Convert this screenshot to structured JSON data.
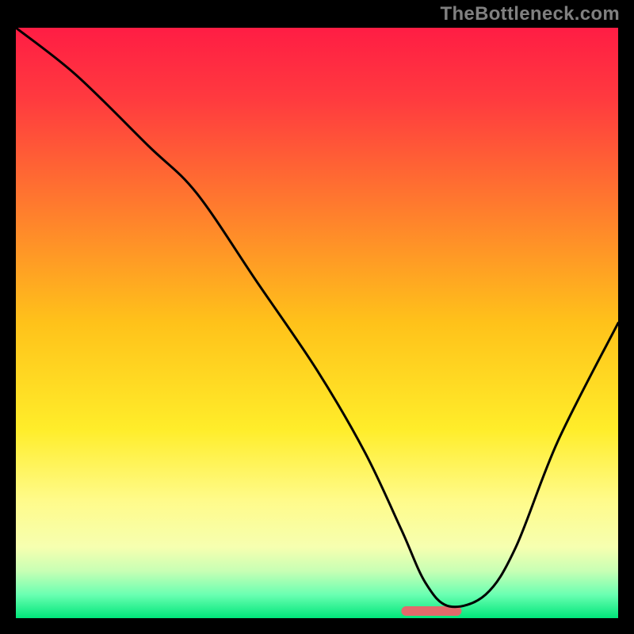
{
  "watermark": "TheBottleneck.com",
  "chart_data": {
    "type": "line",
    "title": "",
    "xlabel": "",
    "ylabel": "",
    "xlim": [
      0,
      100
    ],
    "ylim": [
      0,
      100
    ],
    "legend": false,
    "grid": false,
    "series": [
      {
        "name": "curve",
        "x": [
          0,
          10,
          22,
          30,
          40,
          50,
          58,
          64,
          68,
          72,
          78,
          83,
          90,
          100
        ],
        "y": [
          100,
          92,
          80,
          72,
          57,
          42,
          28,
          15,
          6,
          2,
          4,
          12,
          30,
          50
        ]
      }
    ],
    "marker_band": {
      "x_start": 64,
      "x_end": 74,
      "y": 1.2,
      "color": "#e26a6b"
    },
    "background_gradient_stops": [
      {
        "offset": 0.0,
        "color": "#ff1d44"
      },
      {
        "offset": 0.12,
        "color": "#ff3a3f"
      },
      {
        "offset": 0.3,
        "color": "#ff7a2e"
      },
      {
        "offset": 0.5,
        "color": "#ffc21a"
      },
      {
        "offset": 0.68,
        "color": "#ffed2a"
      },
      {
        "offset": 0.8,
        "color": "#fffb8a"
      },
      {
        "offset": 0.88,
        "color": "#f6ffb0"
      },
      {
        "offset": 0.92,
        "color": "#c8ffb4"
      },
      {
        "offset": 0.96,
        "color": "#6bffb2"
      },
      {
        "offset": 1.0,
        "color": "#00e67a"
      }
    ]
  }
}
